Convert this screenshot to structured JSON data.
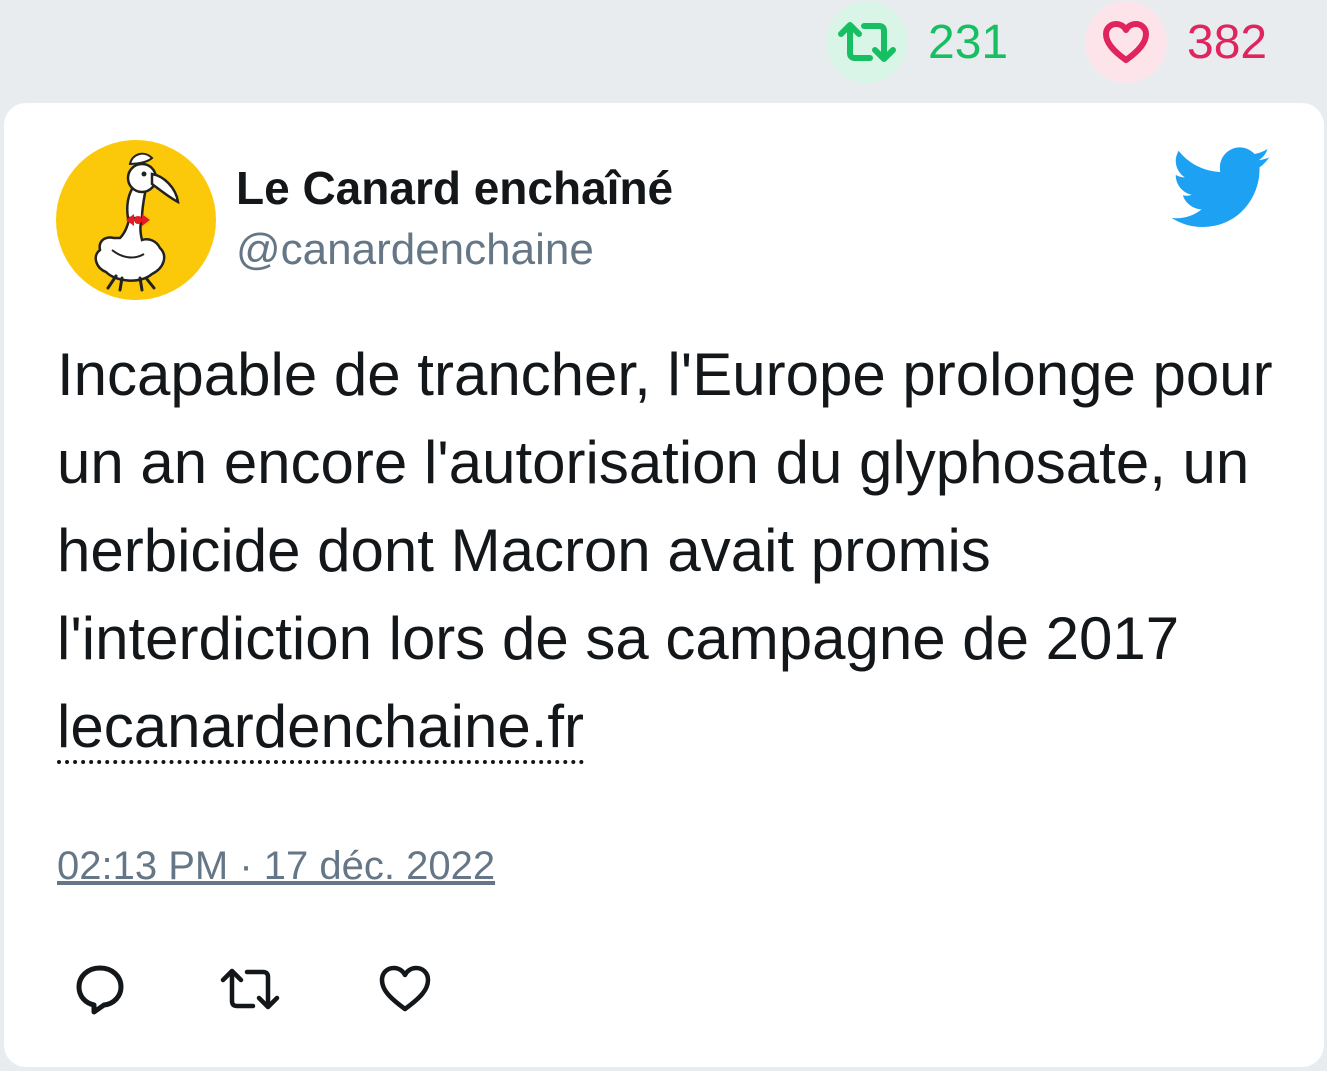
{
  "stats": {
    "retweets": "231",
    "likes": "382"
  },
  "tweet": {
    "author_name": "Le Canard enchaîné",
    "handle": "@canardenchaine",
    "text": "Incapable de trancher, l'Europe prolonge pour un an encore l'autorisation du glyphosate, un herbicide dont Macron avait promis l'interdiction lors de sa campagne de 2017",
    "link_text": "lecanardenchaine.fr",
    "timestamp": "02:13 PM · 17 déc. 2022"
  },
  "icons": {
    "retweet_stat": "retweet-icon",
    "like_stat": "heart-icon",
    "brand": "twitter-bird-icon",
    "actions": [
      "reply-icon",
      "retweet-icon",
      "heart-icon"
    ]
  },
  "colors": {
    "retweet": "#17bf63",
    "like": "#e0245e",
    "twitter_blue": "#1da1f2",
    "avatar_bg": "#fcc90a",
    "muted": "#657786"
  }
}
